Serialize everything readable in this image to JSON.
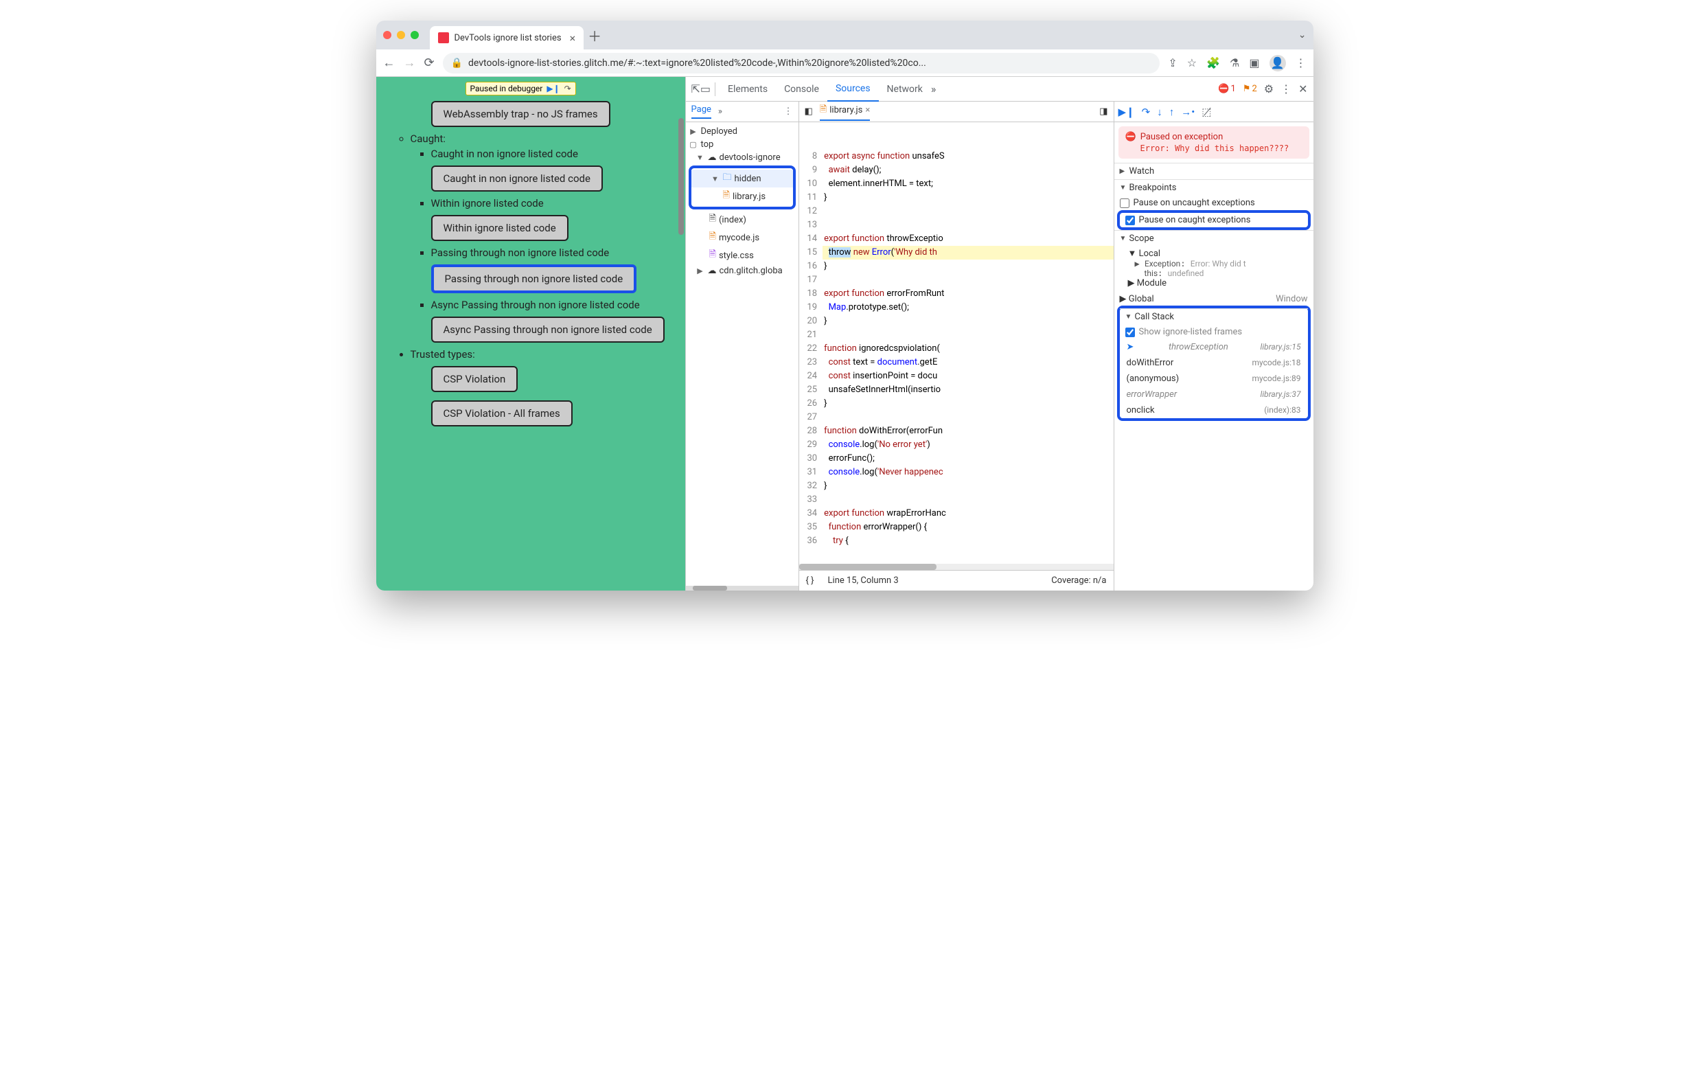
{
  "browser": {
    "tab_title": "DevTools ignore list stories",
    "url": "devtools-ignore-list-stories.glitch.me/#:~:text=ignore%20listed%20code-,Within%20ignore%20listed%20co...",
    "traffic": {
      "red": "#ff5f56",
      "yellow": "#ffbd2e",
      "green": "#27c93f"
    }
  },
  "paused_bar": {
    "label": "Paused in debugger"
  },
  "page": {
    "box_top": "WebAssembly trap - no JS frames",
    "caught_heading": "Caught:",
    "item1_text": "Caught in non ignore listed code",
    "box1": "Caught in non ignore listed code",
    "item2_text": "Within ignore listed code",
    "box2": "Within ignore listed code",
    "item3_text": "Passing through non ignore listed code",
    "box3": "Passing through non ignore listed code",
    "item4_text": "Async Passing through non ignore listed code",
    "box4": "Async Passing through non ignore listed code",
    "trusted_heading": "Trusted types:",
    "csp1": "CSP Violation",
    "csp2": "CSP Violation - All frames"
  },
  "devtools": {
    "tabs": {
      "elements": "Elements",
      "console": "Console",
      "sources": "Sources",
      "network": "Network"
    },
    "error_count": "1",
    "issue_count": "2",
    "nav_tab": "Page",
    "tree": {
      "deployed": "Deployed",
      "top": "top",
      "domain": "devtools-ignore",
      "hidden": "hidden",
      "library": "library.js",
      "index": "(index)",
      "mycode": "mycode.js",
      "style": "style.css",
      "cdn": "cdn.glitch.globa"
    },
    "editor": {
      "filename": "library.js",
      "lines": [
        {
          "n": 8,
          "t": "export async function unsafeS"
        },
        {
          "n": 9,
          "t": "  await delay();"
        },
        {
          "n": 10,
          "t": "  element.innerHTML = text;"
        },
        {
          "n": 11,
          "t": "}"
        },
        {
          "n": 12,
          "t": ""
        },
        {
          "n": 13,
          "t": ""
        },
        {
          "n": 14,
          "t": "export function throwExceptio"
        },
        {
          "n": 15,
          "t": "  throw new Error('Why did th",
          "hl": true
        },
        {
          "n": 16,
          "t": "}"
        },
        {
          "n": 17,
          "t": ""
        },
        {
          "n": 18,
          "t": "export function errorFromRunt"
        },
        {
          "n": 19,
          "t": "  Map.prototype.set();"
        },
        {
          "n": 20,
          "t": "}"
        },
        {
          "n": 21,
          "t": ""
        },
        {
          "n": 22,
          "t": "function ignoredcspviolation("
        },
        {
          "n": 23,
          "t": "  const text = document.getE"
        },
        {
          "n": 24,
          "t": "  const insertionPoint = docu"
        },
        {
          "n": 25,
          "t": "  unsafeSetInnerHtml(insertio"
        },
        {
          "n": 26,
          "t": "}"
        },
        {
          "n": 27,
          "t": ""
        },
        {
          "n": 28,
          "t": "function doWithError(errorFun"
        },
        {
          "n": 29,
          "t": "  console.log('No error yet')"
        },
        {
          "n": 30,
          "t": "  errorFunc();"
        },
        {
          "n": 31,
          "t": "  console.log('Never happenec"
        },
        {
          "n": 32,
          "t": "}"
        },
        {
          "n": 33,
          "t": ""
        },
        {
          "n": 34,
          "t": "export function wrapErrorHanc"
        },
        {
          "n": 35,
          "t": "  function errorWrapper() {"
        },
        {
          "n": 36,
          "t": "    try {"
        }
      ],
      "status_line": "Line 15, Column 3",
      "coverage": "Coverage: n/a"
    },
    "debugger": {
      "pause_title": "Paused on exception",
      "pause_msg": "Error: Why did this happen????",
      "watch": "Watch",
      "breakpoints": "Breakpoints",
      "bp_uncaught": "Pause on uncaught exceptions",
      "bp_caught": "Pause on caught exceptions",
      "scope": "Scope",
      "local": "Local",
      "exception_label": "Exception",
      "exception_val": "Error: Why did t",
      "this_label": "this",
      "this_val": "undefined",
      "module": "Module",
      "global": "Global",
      "global_val": "Window",
      "callstack": "Call Stack",
      "show_ignored": "Show ignore-listed frames",
      "frames": [
        {
          "name": "throwException",
          "loc": "library.js:15",
          "muted": true,
          "current": true
        },
        {
          "name": "doWithError",
          "loc": "mycode.js:18"
        },
        {
          "name": "(anonymous)",
          "loc": "mycode.js:89"
        },
        {
          "name": "errorWrapper",
          "loc": "library.js:37",
          "muted": true
        },
        {
          "name": "onclick",
          "loc": "(index):83"
        }
      ]
    }
  }
}
